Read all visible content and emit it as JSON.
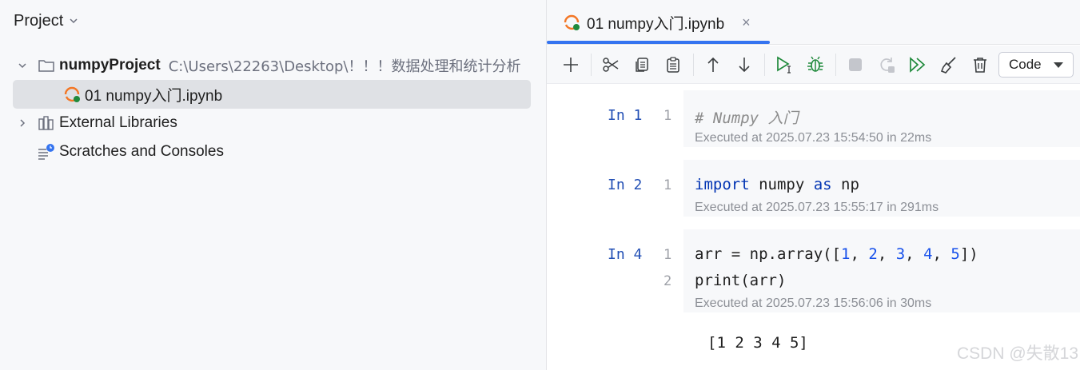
{
  "project_panel": {
    "title": "Project",
    "tree": {
      "project": {
        "name": "numpyProject",
        "path": "C:\\Users\\22263\\Desktop\\！！！数据处理和统计分析"
      },
      "notebook_file": "01 numpy入门.ipynb",
      "external_libraries": "External Libraries",
      "scratches": "Scratches and Consoles"
    }
  },
  "editor": {
    "tab": {
      "label": "01 numpy入门.ipynb",
      "close": "×"
    },
    "toolbar": {
      "icons": [
        "add-cell-icon",
        "cut-icon",
        "copy-icon",
        "paste-icon",
        "move-up-icon",
        "move-down-icon",
        "run-cell-icon",
        "debug-icon",
        "stop-icon",
        "restart-icon",
        "run-all-icon",
        "clear-outputs-icon",
        "delete-icon"
      ],
      "cell_type": "Code"
    },
    "cells": [
      {
        "label": "In 1",
        "line_numbers": [
          "1"
        ],
        "lines": [
          "# Numpy 入门"
        ],
        "executed": "Executed at 2025.07.23 15:54:50 in 22ms"
      },
      {
        "label": "In 2",
        "line_numbers": [
          "1"
        ],
        "tokens": {
          "import": "import",
          "module": " numpy ",
          "as": "as",
          "alias": " np"
        },
        "executed": "Executed at 2025.07.23 15:55:17 in 291ms"
      },
      {
        "label": "In 4",
        "line_numbers": [
          "1",
          "2"
        ],
        "tokens": {
          "prefix": "arr = np.array([",
          "n1": "1",
          "n2": "2",
          "n3": "3",
          "n4": "4",
          "n5": "5",
          "sep": ", ",
          "suffix": "])",
          "line2": "print(arr)"
        },
        "executed": "Executed at 2025.07.23 15:56:06 in 30ms",
        "output": "[1 2 3 4 5]"
      }
    ]
  },
  "watermark": "CSDN @失散13",
  "colors": {
    "accent": "#3574f0",
    "keyword": "#0033b3",
    "number": "#1750eb",
    "run_green": "#208a3c"
  }
}
